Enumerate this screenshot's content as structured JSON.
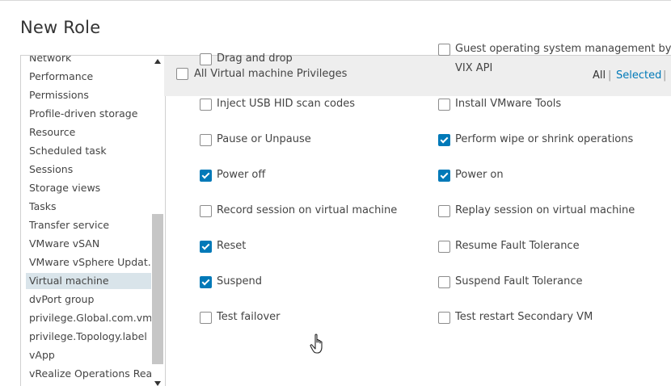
{
  "dialog": {
    "title": "New Role"
  },
  "categories": [
    {
      "label": "Network",
      "selected": false
    },
    {
      "label": "Performance",
      "selected": false
    },
    {
      "label": "Permissions",
      "selected": false
    },
    {
      "label": "Profile-driven storage",
      "selected": false
    },
    {
      "label": "Resource",
      "selected": false
    },
    {
      "label": "Scheduled task",
      "selected": false
    },
    {
      "label": "Sessions",
      "selected": false
    },
    {
      "label": "Storage views",
      "selected": false
    },
    {
      "label": "Tasks",
      "selected": false
    },
    {
      "label": "Transfer service",
      "selected": false
    },
    {
      "label": "VMware vSAN",
      "selected": false
    },
    {
      "label": "VMware vSphere Updat...",
      "selected": false
    },
    {
      "label": "Virtual machine",
      "selected": true
    },
    {
      "label": "dvPort group",
      "selected": false
    },
    {
      "label": "privilege.Global.com.vm...",
      "selected": false
    },
    {
      "label": "privilege.Topology.label",
      "selected": false
    },
    {
      "label": "vApp",
      "selected": false
    },
    {
      "label": "vRealize Operations Rea...",
      "selected": false
    }
  ],
  "privileges_header": {
    "all_label": "All Virtual machine Privileges",
    "all_checked": false,
    "filter_all": "All",
    "filter_separator": "|",
    "filter_selected": "Selected"
  },
  "privileges_left": [
    {
      "label": "Drag and drop",
      "checked": false
    },
    {
      "label": "Inject USB HID scan codes",
      "checked": false
    },
    {
      "label": "Pause or Unpause",
      "checked": false
    },
    {
      "label": "Power off",
      "checked": true
    },
    {
      "label": "Record session on virtual machine",
      "checked": false
    },
    {
      "label": "Reset",
      "checked": true
    },
    {
      "label": "Suspend",
      "checked": true
    },
    {
      "label": "Test failover",
      "checked": false
    }
  ],
  "privileges_right": [
    {
      "label": "Guest operating system management by",
      "label2": "VIX API",
      "checked": false
    },
    {
      "label": "Install VMware Tools",
      "checked": false
    },
    {
      "label": "Perform wipe or shrink operations",
      "checked": true
    },
    {
      "label": "Power on",
      "checked": true
    },
    {
      "label": "Replay session on virtual machine",
      "checked": false
    },
    {
      "label": "Resume Fault Tolerance",
      "checked": false
    },
    {
      "label": "Suspend Fault Tolerance",
      "checked": false
    },
    {
      "label": "Test restart Secondary VM",
      "checked": false
    }
  ],
  "icons": {
    "scroll_up": "triangle-up",
    "scroll_down": "triangle-down",
    "cursor": "hand-pointer"
  },
  "colors": {
    "accent": "#0079b8",
    "selected_row": "#d9e4ea",
    "header_bg": "#eeeeee"
  }
}
